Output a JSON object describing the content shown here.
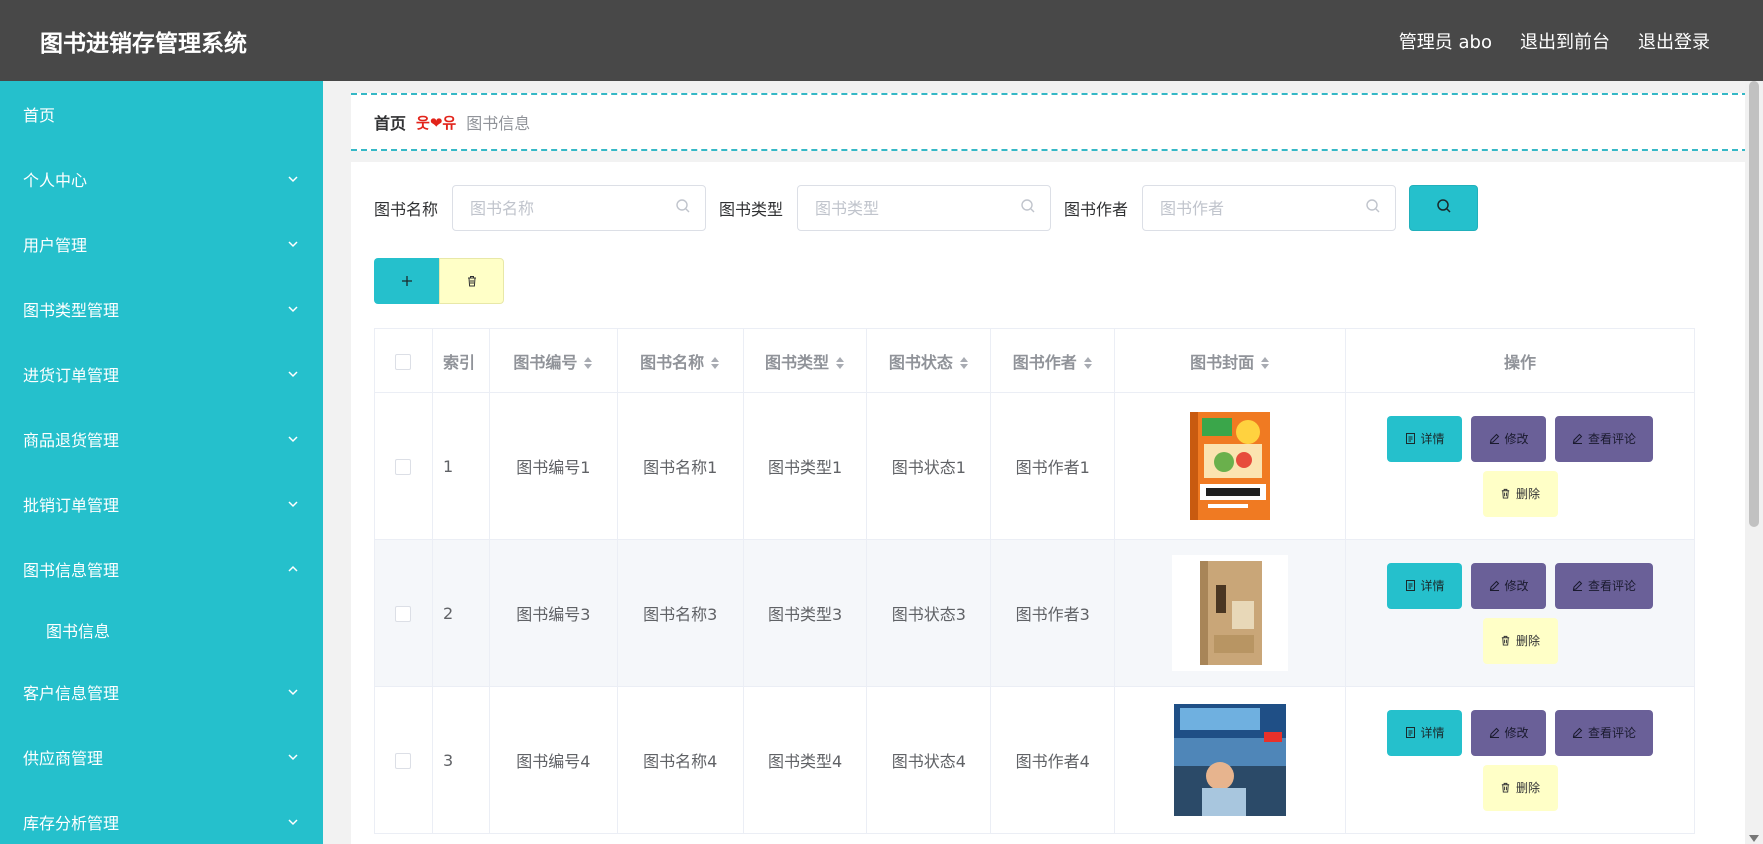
{
  "header": {
    "title": "图书进销存管理系统",
    "user": "管理员 abo",
    "to_front": "退出到前台",
    "logout": "退出登录"
  },
  "sidebar": {
    "items": [
      {
        "label": "首页"
      },
      {
        "label": "个人中心"
      },
      {
        "label": "用户管理"
      },
      {
        "label": "图书类型管理"
      },
      {
        "label": "进货订单管理"
      },
      {
        "label": "商品退货管理"
      },
      {
        "label": "批销订单管理"
      },
      {
        "label": "图书信息管理"
      },
      {
        "label": "图书信息"
      },
      {
        "label": "客户信息管理"
      },
      {
        "label": "供应商管理"
      },
      {
        "label": "库存分析管理"
      }
    ]
  },
  "breadcrumb": {
    "home": "首页",
    "separator": "웃❤유",
    "current": "图书信息"
  },
  "search": {
    "name_label": "图书名称",
    "name_placeholder": "图书名称",
    "type_label": "图书类型",
    "type_placeholder": "图书类型",
    "author_label": "图书作者",
    "author_placeholder": "图书作者"
  },
  "table": {
    "headers": {
      "index": "索引",
      "code": "图书编号",
      "name": "图书名称",
      "type": "图书类型",
      "status": "图书状态",
      "author": "图书作者",
      "cover": "图书封面",
      "actions": "操作"
    },
    "rows": [
      {
        "index": "1",
        "code": "图书编号1",
        "name": "图书名称1",
        "type": "图书类型1",
        "status": "图书状态1",
        "author": "图书作者1"
      },
      {
        "index": "2",
        "code": "图书编号3",
        "name": "图书名称3",
        "type": "图书类型3",
        "status": "图书状态3",
        "author": "图书作者3"
      },
      {
        "index": "3",
        "code": "图书编号4",
        "name": "图书名称4",
        "type": "图书类型4",
        "status": "图书状态4",
        "author": "图书作者4"
      }
    ],
    "actions": {
      "detail": "详情",
      "edit": "修改",
      "comment": "查看评论",
      "delete": "删除"
    }
  },
  "colors": {
    "header_bg": "#484848",
    "sidebar_bg": "#25c0cc",
    "primary": "#25c0cc",
    "purple": "#6a6098",
    "warn_bg": "#ffffc7"
  }
}
